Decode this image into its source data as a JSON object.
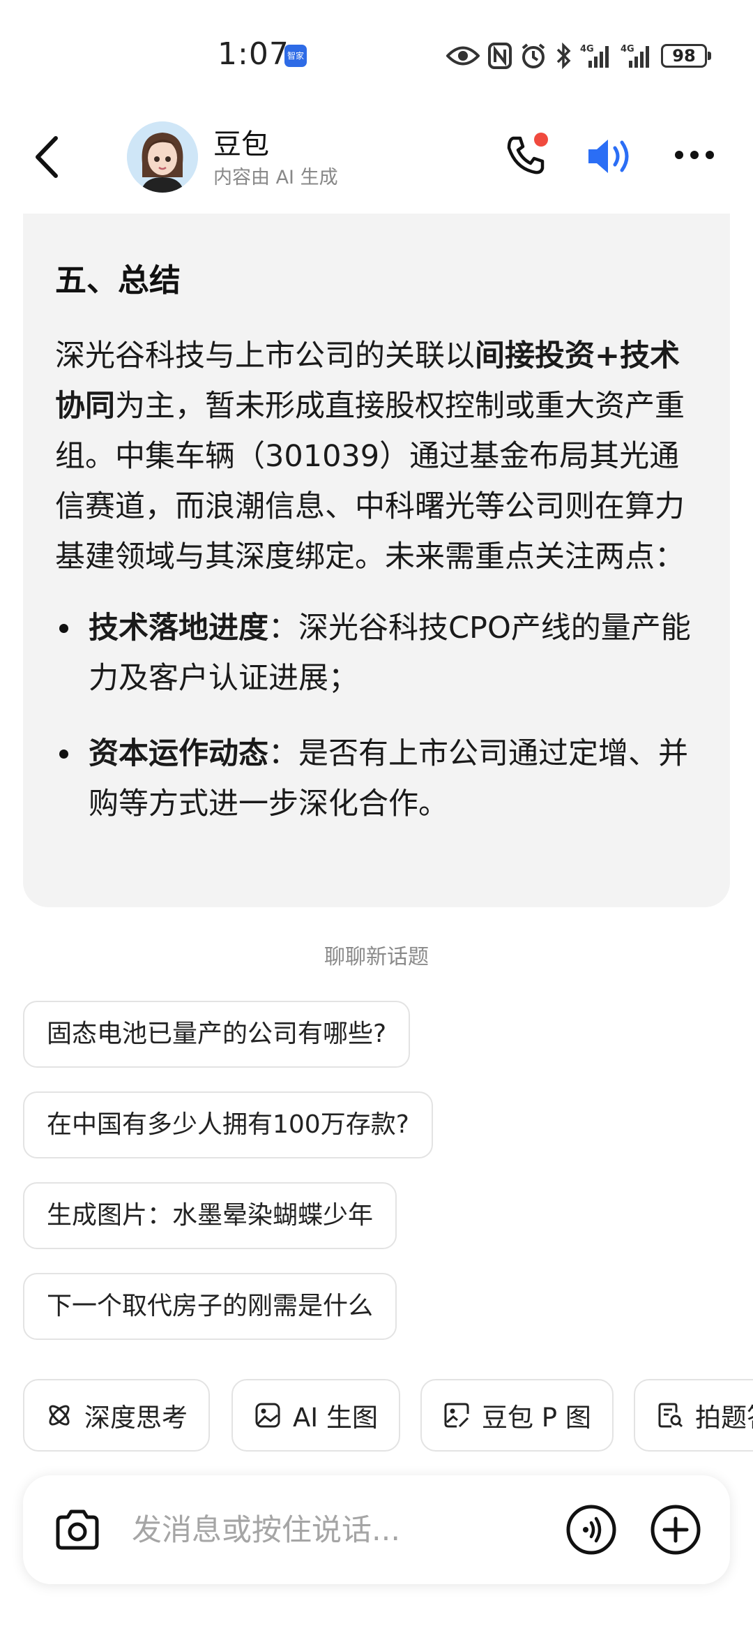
{
  "status_bar": {
    "time": "1:07",
    "app_icon_label": "智家",
    "network_1": "4G",
    "network_2": "4G",
    "battery": "98"
  },
  "header": {
    "name": "豆包",
    "subtitle": "内容由 AI 生成",
    "call_dot_color": "#f04a3e",
    "speaker_color": "#2b6ef5"
  },
  "message": {
    "heading": "五、总结",
    "para": {
      "t1": "深光谷科技与上市公司的关联以",
      "b1": "间接投资+技术协同",
      "t2": "为主，暂未形成直接股权控制或重大资产重组。中集车辆（301039）通过基金布局其光通信赛道，而浪潮信息、中科曙光等公司则在算力基建领域与其深度绑定。未来需重点关注两点："
    },
    "bullets": [
      {
        "bold": "技术落地进度",
        "text": "：深光谷科技CPO产线的量产能力及客户认证进展；"
      },
      {
        "bold": "资本运作动态",
        "text": "：是否有上市公司通过定增、并购等方式进一步深化合作。"
      }
    ]
  },
  "suggestions": {
    "title": "聊聊新话题",
    "items": [
      "固态电池已量产的公司有哪些?",
      "在中国有多少人拥有100万存款?",
      "生成图片：水墨晕染蝴蝶少年",
      "下一个取代房子的刚需是什么"
    ]
  },
  "tools": [
    {
      "label": "深度思考",
      "icon": "atom-icon"
    },
    {
      "label": "AI 生图",
      "icon": "image-icon"
    },
    {
      "label": "豆包 P 图",
      "icon": "image-edit-icon"
    },
    {
      "label": "拍题答疑",
      "icon": "doc-search-icon"
    }
  ],
  "input": {
    "placeholder": "发消息或按住说话..."
  }
}
